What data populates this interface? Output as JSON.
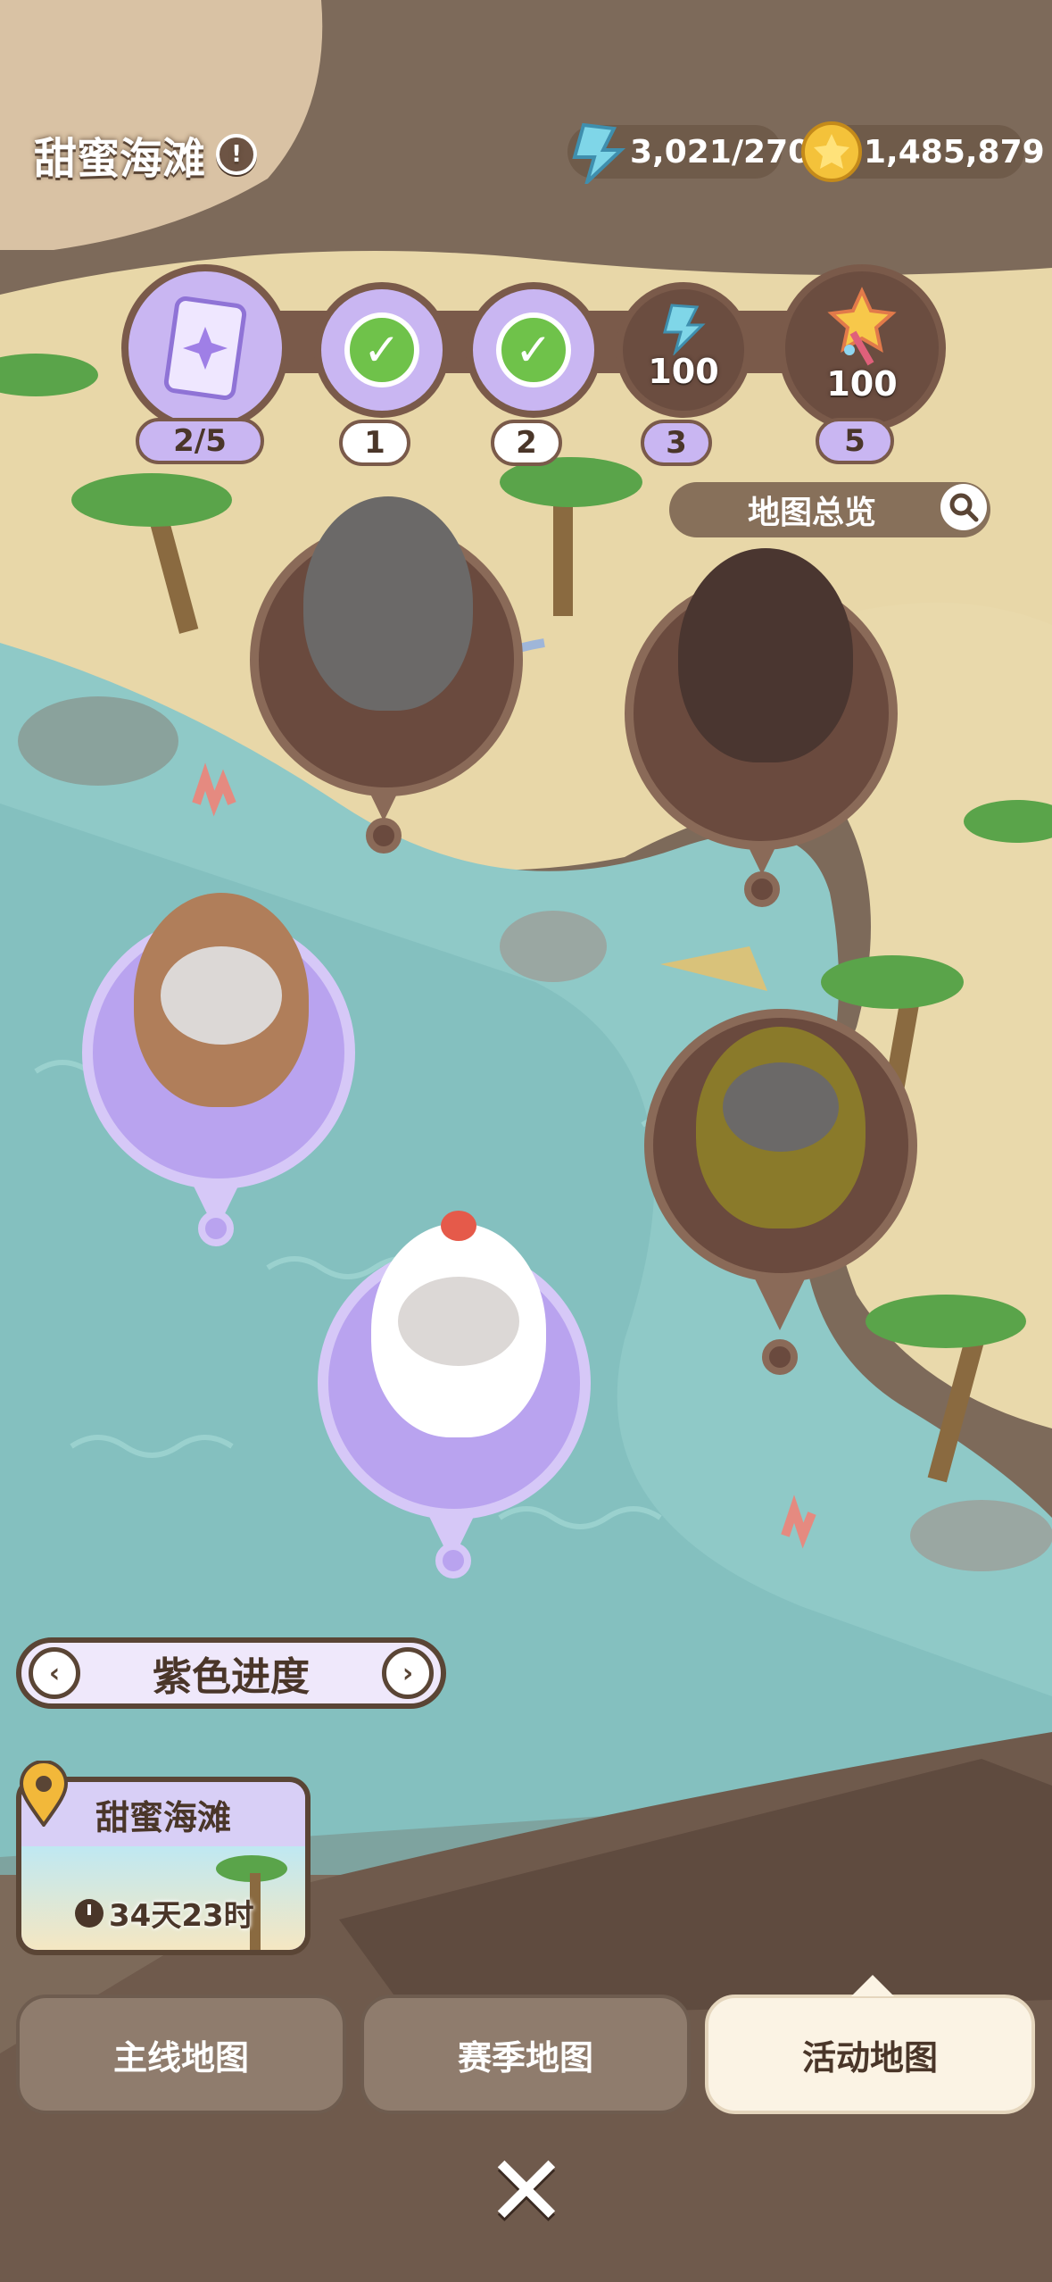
{
  "header": {
    "title": "甜蜜海滩",
    "energy": "3,021/270",
    "coins": "1,485,879"
  },
  "progress_track": {
    "card_count": "2/5",
    "milestones": [
      {
        "label": "1",
        "state": "claimed"
      },
      {
        "label": "2",
        "state": "claimed"
      },
      {
        "label": "3",
        "reward": "100",
        "reward_icon": "crystal-icon"
      },
      {
        "label": "5",
        "reward": "100",
        "reward_icon": "magic-wand-icon"
      }
    ]
  },
  "map": {
    "overview_label": "地图总览",
    "pins": [
      {
        "name": "gray-cat",
        "state": "locked"
      },
      {
        "name": "shadow-cat",
        "state": "unknown"
      },
      {
        "name": "capybara-cat",
        "state": "unlocked"
      },
      {
        "name": "bee-cat",
        "state": "locked"
      },
      {
        "name": "panda-cat",
        "state": "unlocked"
      }
    ]
  },
  "progress_selector": {
    "label": "紫色进度"
  },
  "event": {
    "name": "甜蜜海滩",
    "time_left": "34天23时"
  },
  "tabs": [
    {
      "label": "主线地图",
      "active": false
    },
    {
      "label": "赛季地图",
      "active": false
    },
    {
      "label": "活动地图",
      "active": true
    }
  ],
  "colors": {
    "purple": "#c9b6f2",
    "brown": "#7a5a4a",
    "sea": "#8fc9c7",
    "sand": "#e9d9ab"
  }
}
